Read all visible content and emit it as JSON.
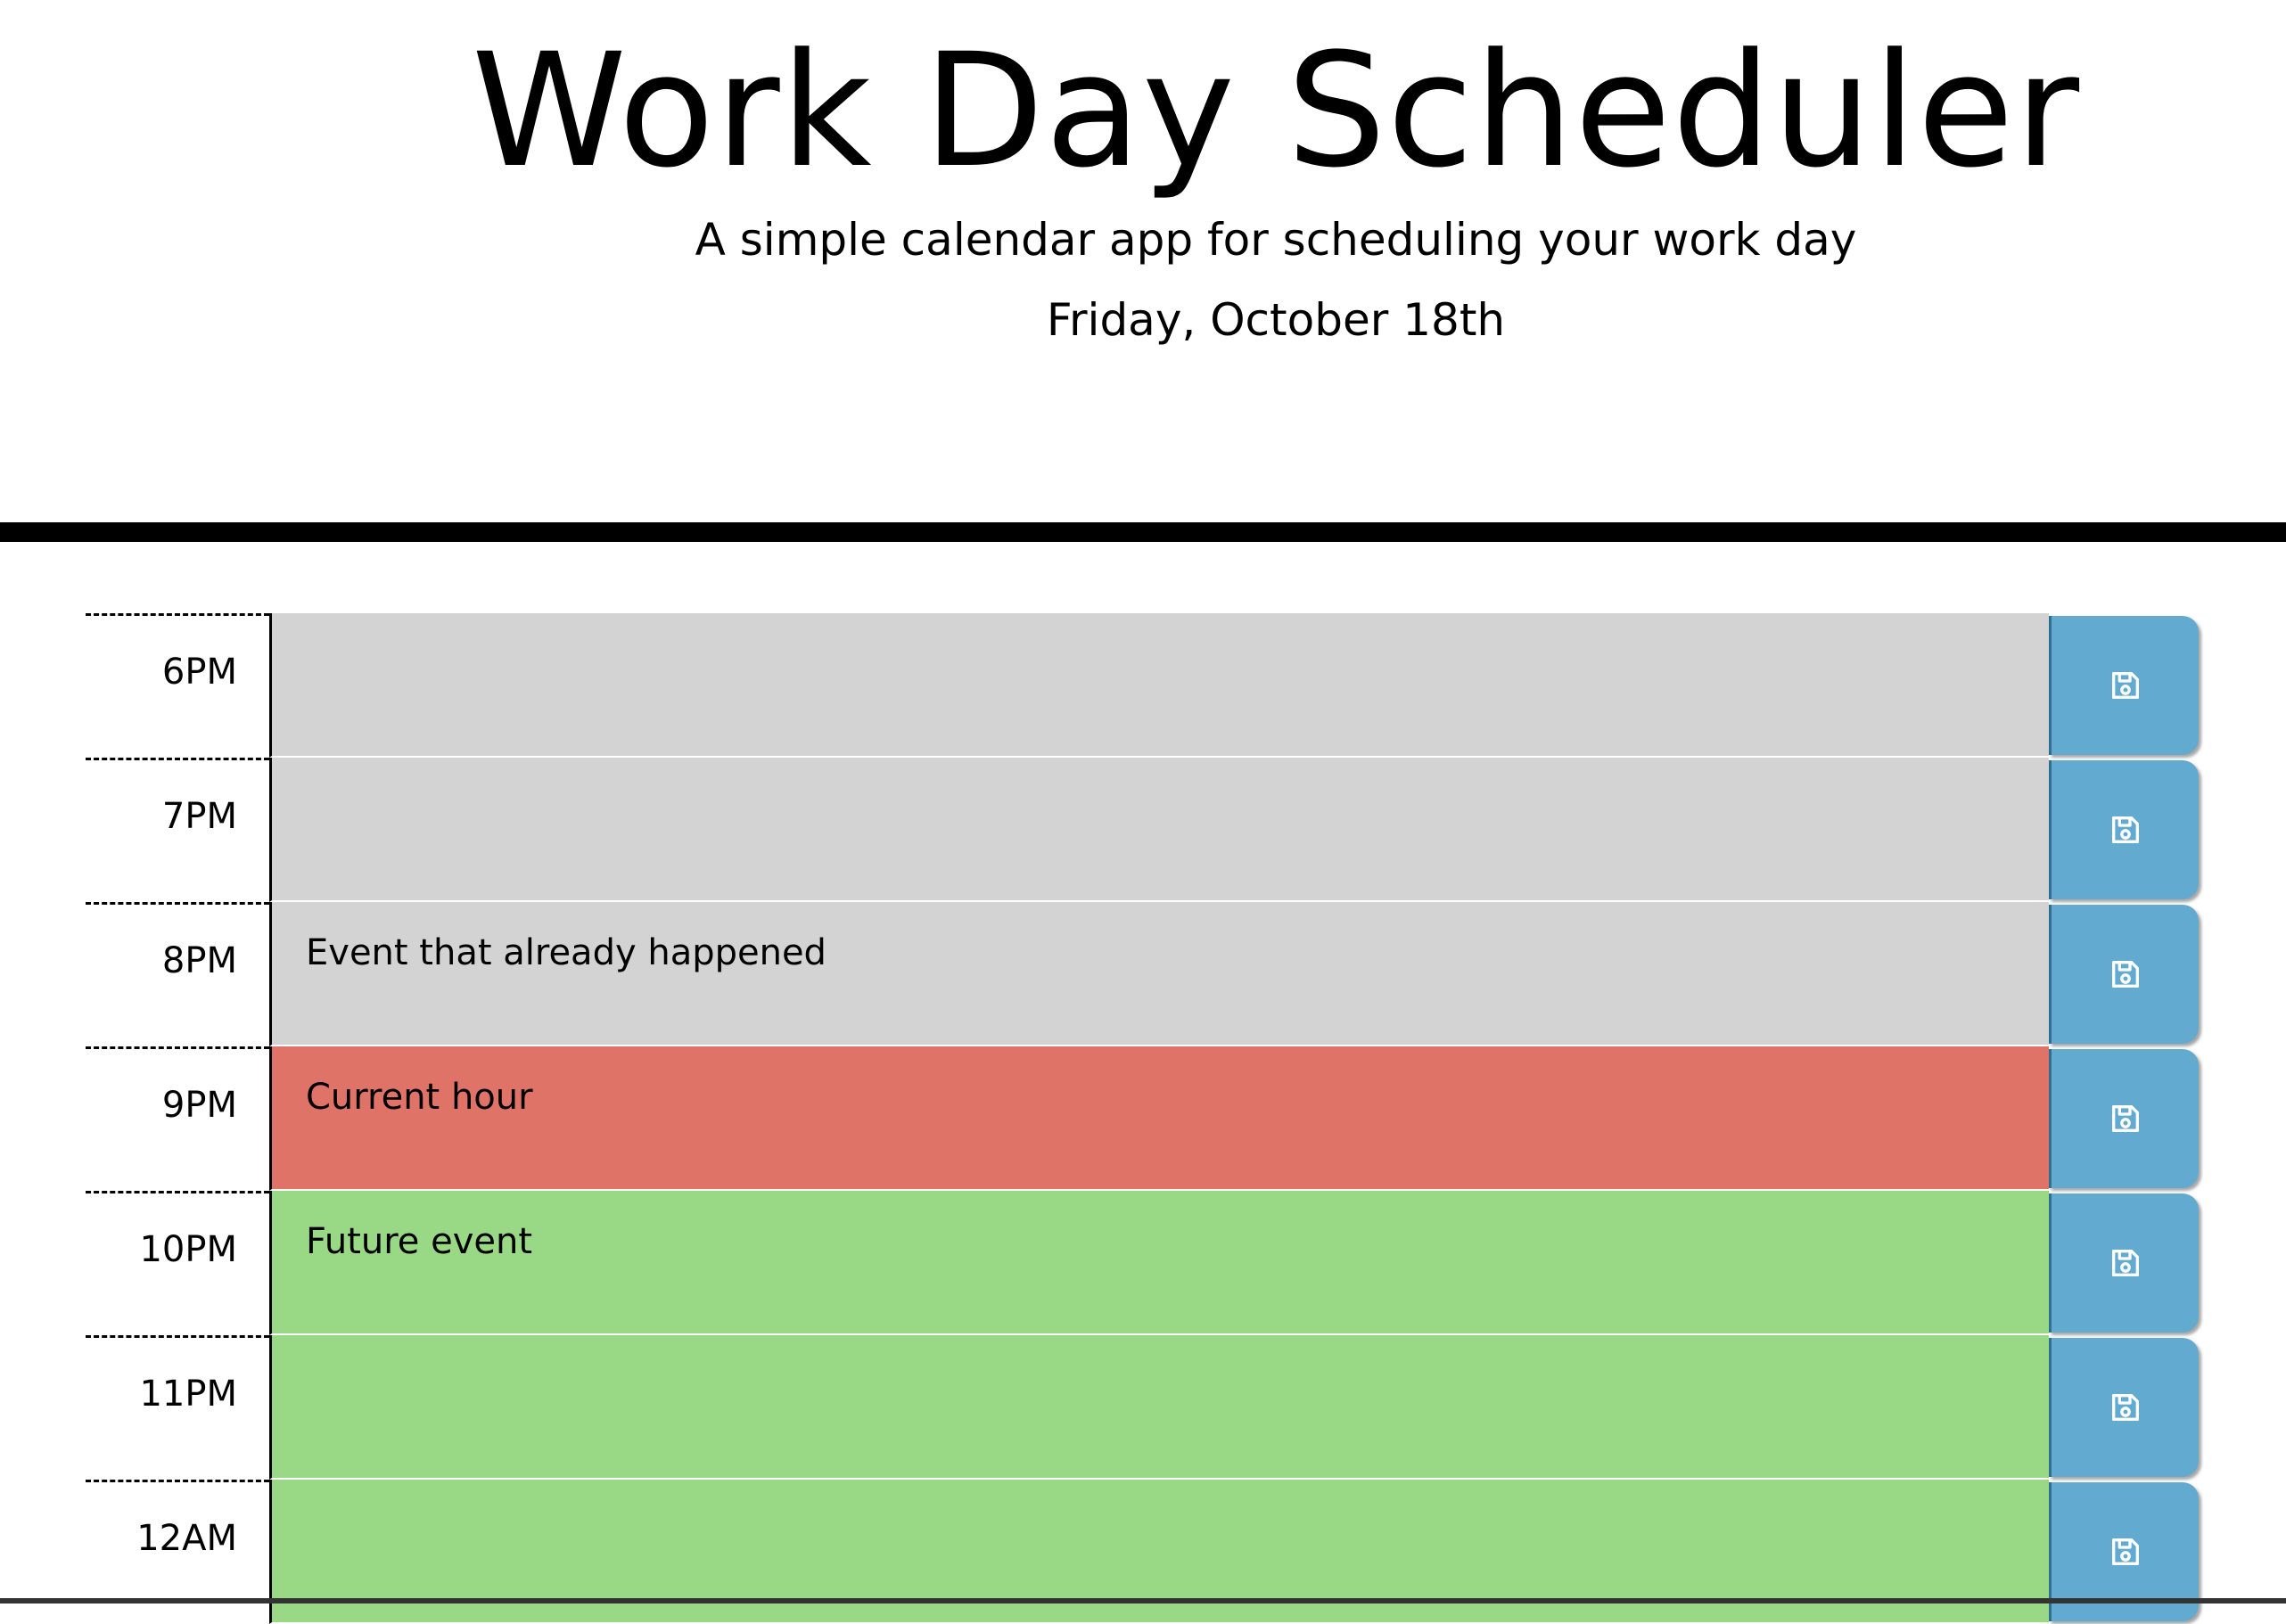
{
  "header": {
    "title": "Work Day Scheduler",
    "subtitle": "A simple calendar app for scheduling your work day",
    "current_day": "Friday, October 18th"
  },
  "colors": {
    "past": "#d3d3d3",
    "present": "#e07368",
    "future": "#99d986",
    "save_button": "#63aad1"
  },
  "time_blocks": [
    {
      "hour": "6PM",
      "text": "",
      "status": "past",
      "icon": "save-icon"
    },
    {
      "hour": "7PM",
      "text": "",
      "status": "past",
      "icon": "save-icon"
    },
    {
      "hour": "8PM",
      "text": "Event that already happened",
      "status": "past",
      "icon": "save-icon"
    },
    {
      "hour": "9PM",
      "text": "Current hour",
      "status": "present",
      "icon": "save-icon"
    },
    {
      "hour": "10PM",
      "text": "Future event",
      "status": "future",
      "icon": "save-icon"
    },
    {
      "hour": "11PM",
      "text": "",
      "status": "future",
      "icon": "save-icon"
    },
    {
      "hour": "12AM",
      "text": "",
      "status": "future",
      "icon": "save-icon"
    }
  ]
}
